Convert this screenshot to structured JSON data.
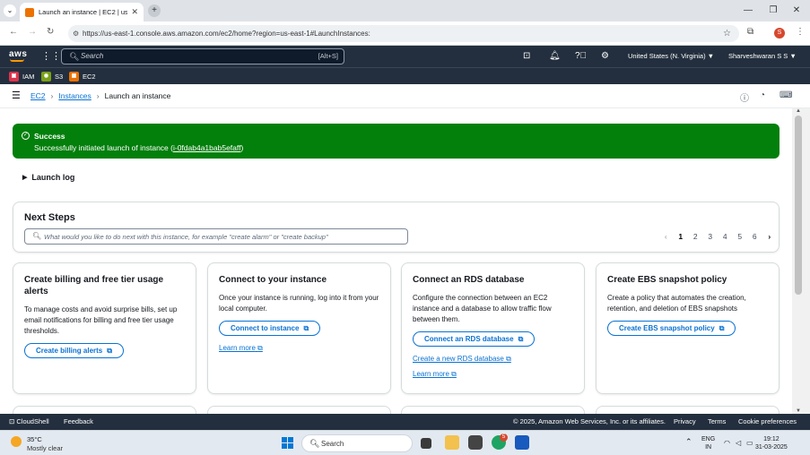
{
  "browser": {
    "tab_title": "Launch an instance | EC2 | us-e...",
    "url": "https://us-east-1.console.aws.amazon.com/ec2/home?region=us-east-1#LaunchInstances:",
    "profile_initial": "S"
  },
  "aws_nav": {
    "logo": "aws",
    "search_placeholder": "Search",
    "search_shortcut": "[Alt+S]",
    "region": "United States (N. Virginia) ▼",
    "user": "Sharveshwaran S S ▼"
  },
  "favorites": [
    {
      "label": "IAM",
      "color": "#dd344c",
      "abbr": "IAM"
    },
    {
      "label": "S3",
      "color": "#7aa116",
      "abbr": "S3"
    },
    {
      "label": "EC2",
      "color": "#ed7100",
      "abbr": "EC2"
    }
  ],
  "breadcrumb": {
    "ec2": "EC2",
    "instances": "Instances",
    "current": "Launch an instance"
  },
  "flash": {
    "title": "Success",
    "message": "Successfully initiated launch of instance (",
    "instance_id": "i-0fdab4a1bab5efaff",
    "message_end": ")",
    "color": "#037f0c"
  },
  "launch_log": "Launch log",
  "next_steps": {
    "title": "Next Steps",
    "search_placeholder": "What would you like to do next with this instance, for example \"create alarm\" or \"create backup\"",
    "pages": [
      "1",
      "2",
      "3",
      "4",
      "5",
      "6"
    ],
    "current_page": "1"
  },
  "cards": [
    {
      "title": "Create billing and free tier usage alerts",
      "text": "To manage costs and avoid surprise bills, set up email notifications for billing and free tier usage thresholds.",
      "button": "Create billing alerts"
    },
    {
      "title": "Connect to your instance",
      "text": "Once your instance is running, log into it from your local computer.",
      "button": "Connect to instance",
      "link": "Learn more"
    },
    {
      "title": "Connect an RDS database",
      "text": "Configure the connection between an EC2 instance and a database to allow traffic flow between them.",
      "button": "Connect an RDS database",
      "link": "Create a new RDS database",
      "link2": "Learn more"
    },
    {
      "title": "Create EBS snapshot policy",
      "text": "Create a policy that automates the creation, retention, and deletion of EBS snapshots",
      "button": "Create EBS snapshot policy"
    }
  ],
  "footer": {
    "cloudshell": "CloudShell",
    "feedback": "Feedback",
    "copyright": "© 2025, Amazon Web Services, Inc. or its affiliates.",
    "privacy": "Privacy",
    "terms": "Terms",
    "cookies": "Cookie preferences"
  },
  "taskbar": {
    "temperature": "35°C",
    "weather": "Mostly clear",
    "search": "Search",
    "lang_top": "ENG",
    "lang_bottom": "IN",
    "time": "19:12",
    "date": "31-03-2025",
    "chrome_badge": "5"
  }
}
